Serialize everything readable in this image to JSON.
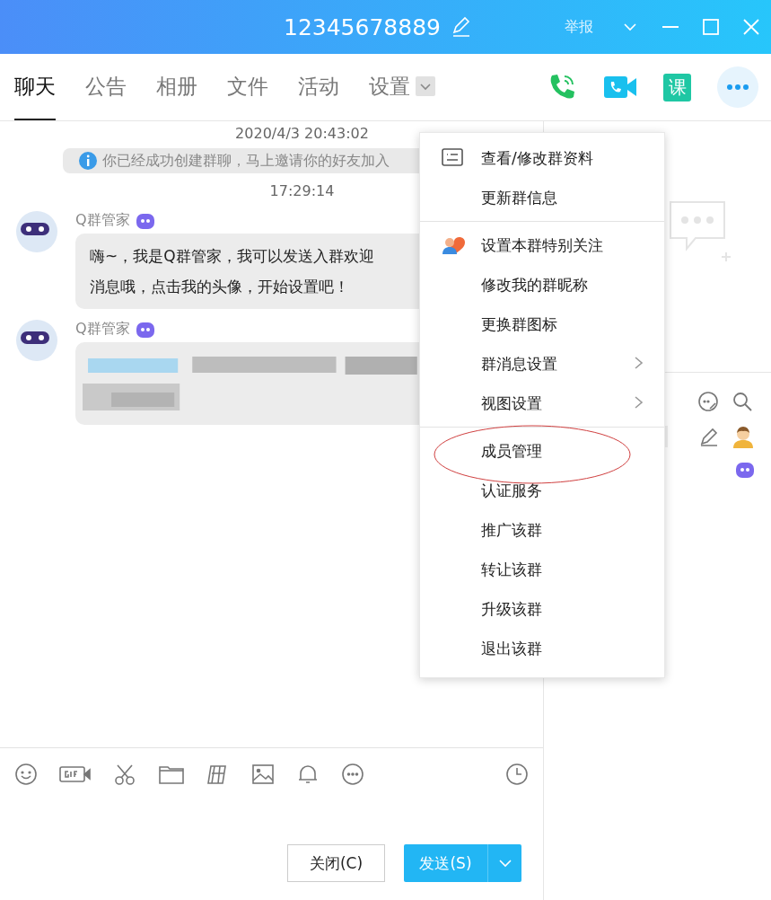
{
  "window": {
    "title": "12345678889",
    "report": "举报"
  },
  "tabs": [
    {
      "label": "聊天",
      "selected": true
    },
    {
      "label": "公告",
      "selected": false
    },
    {
      "label": "相册",
      "selected": false
    },
    {
      "label": "文件",
      "selected": false
    },
    {
      "label": "活动",
      "selected": false
    },
    {
      "label": "设置",
      "selected": false
    }
  ],
  "course_button": "课",
  "messages": [
    {
      "kind": "time",
      "text": "2020/4/3 20:43:02"
    },
    {
      "kind": "notice",
      "text": "你已经成功创建群聊，马上邀请你的好友加入"
    },
    {
      "kind": "time",
      "text": "17:29:14"
    },
    {
      "kind": "bubble",
      "sender": "Q群管家",
      "lines": [
        "嗨~，我是Q群管家，我可以发送入群欢迎",
        "消息哦，点击我的头像，开始设置吧！"
      ]
    },
    {
      "kind": "blurred",
      "sender": "Q群管家"
    }
  ],
  "menu": {
    "groups": [
      [
        {
          "label": "查看/修改群资料",
          "kind": "card"
        },
        {
          "label": "更新群信息",
          "kind": "plain"
        }
      ],
      [
        {
          "label": "设置本群特别关注",
          "kind": "heart"
        },
        {
          "label": "修改我的群昵称",
          "kind": "plain"
        },
        {
          "label": "更换群图标",
          "kind": "plain"
        },
        {
          "label": "群消息设置",
          "kind": "submenu"
        },
        {
          "label": "视图设置",
          "kind": "submenu"
        }
      ],
      [
        {
          "label": "成员管理",
          "kind": "circled"
        },
        {
          "label": "认证服务",
          "kind": "plain"
        },
        {
          "label": "推广该群",
          "kind": "plain"
        },
        {
          "label": "转让该群",
          "kind": "plain"
        },
        {
          "label": "升级该群",
          "kind": "plain"
        },
        {
          "label": "退出该群",
          "kind": "plain"
        }
      ]
    ]
  },
  "buttons": {
    "close": "关闭(C)",
    "send": "发送(S)"
  }
}
